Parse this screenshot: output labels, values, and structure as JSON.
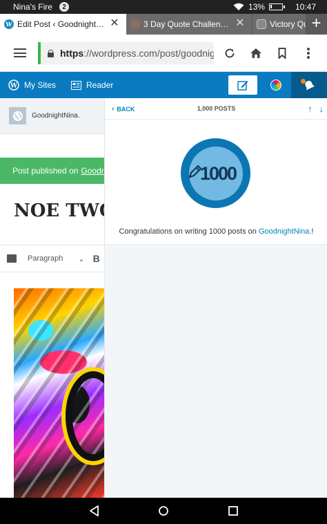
{
  "status_bar": {
    "device_name": "Nina's Fire",
    "notification_count": "2",
    "battery": "13%",
    "battery_level": 0.13,
    "time": "10:47"
  },
  "tabs": [
    {
      "title": "Edit Post ‹ Goodnight…",
      "active": true
    },
    {
      "title": "3 Day Quote Challen…",
      "active": false
    },
    {
      "title": "Victory Qu",
      "active": false
    }
  ],
  "url": {
    "scheme": "https",
    "rest": "://wordpress.com/post/goodnightr"
  },
  "wp_bar": {
    "my_sites": "My Sites",
    "reader": "Reader"
  },
  "editor": {
    "site_name": "GoodnightNina.",
    "notice_text": "Post published on",
    "notice_link": "Goodn",
    "post_title": "NOE TWO",
    "block_type": "Paragraph",
    "bold_label": "B"
  },
  "notification_panel": {
    "back_label": "BACK",
    "header_title": "1,000 POSTS",
    "badge_number": "1000",
    "message_prefix": "Congratulations on writing 1000 posts on ",
    "message_site": "GoodnightNina.",
    "message_suffix": "!"
  },
  "colors": {
    "wp_blue": "#0a7bc0",
    "success_green": "#4ab866",
    "link_blue": "#0087be",
    "badge_blue": "#0c76b2"
  }
}
